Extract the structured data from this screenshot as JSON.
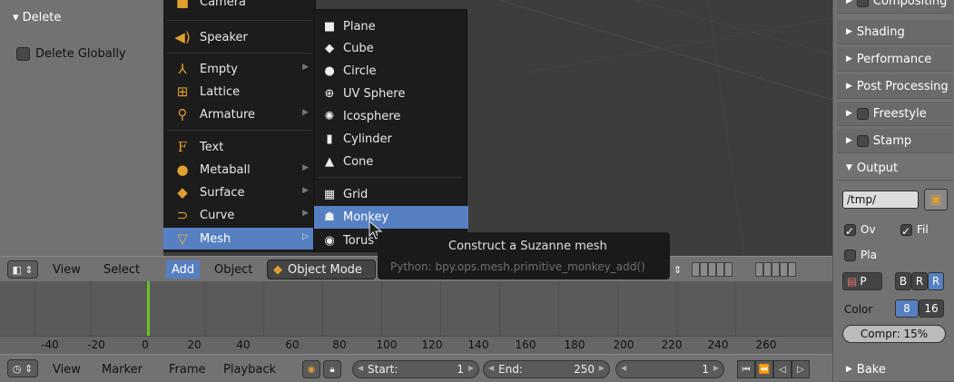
{
  "operator_panel": {
    "header": "Delete",
    "delete_globally_label": "Delete Globally"
  },
  "add_menu": {
    "items": [
      {
        "label": "Camera",
        "icon": "camera-icon"
      },
      {
        "label": "Speaker",
        "icon": "speaker-icon"
      },
      {
        "label": "Empty",
        "icon": "empty-icon"
      },
      {
        "label": "Lattice",
        "icon": "lattice-icon"
      },
      {
        "label": "Armature",
        "icon": "armature-icon"
      },
      {
        "label": "Text",
        "icon": "text-icon"
      },
      {
        "label": "Metaball",
        "icon": "metaball-icon"
      },
      {
        "label": "Surface",
        "icon": "surface-icon"
      },
      {
        "label": "Curve",
        "icon": "curve-icon"
      },
      {
        "label": "Mesh",
        "icon": "mesh-icon"
      }
    ]
  },
  "mesh_menu": {
    "items": [
      {
        "label": "Plane",
        "icon": "plane-icon"
      },
      {
        "label": "Cube",
        "icon": "cube-icon"
      },
      {
        "label": "Circle",
        "icon": "circle-icon"
      },
      {
        "label": "UV Sphere",
        "icon": "uv-sphere-icon"
      },
      {
        "label": "Icosphere",
        "icon": "icosphere-icon"
      },
      {
        "label": "Cylinder",
        "icon": "cylinder-icon"
      },
      {
        "label": "Cone",
        "icon": "cone-icon"
      },
      {
        "label": "Grid",
        "icon": "grid-icon"
      },
      {
        "label": "Monkey",
        "icon": "monkey-icon"
      },
      {
        "label": "Torus",
        "icon": "torus-icon"
      }
    ]
  },
  "tooltip": {
    "title": "Construct a Suzanne mesh",
    "python": "Python: bpy.ops.mesh.primitive_monkey_add()"
  },
  "viewport_header": {
    "view": "View",
    "select": "Select",
    "add": "Add",
    "object": "Object",
    "mode": "Object Mode"
  },
  "timeline": {
    "ticks": [
      "-40",
      "-20",
      "0",
      "20",
      "40",
      "60",
      "80",
      "100",
      "120",
      "140",
      "160",
      "180",
      "200",
      "220",
      "240",
      "260"
    ],
    "current_frame_value": 0
  },
  "timeline_header": {
    "view": "View",
    "marker": "Marker",
    "frame": "Frame",
    "playback": "Playback",
    "start_label": "Start:",
    "start_value": "1",
    "end_label": "End:",
    "end_value": "250",
    "current_value": "1"
  },
  "properties": {
    "top_partial": "Compositing",
    "shading": "Shading",
    "performance": "Performance",
    "post_processing": "Post Processing",
    "freestyle": "Freestyle",
    "stamp": "Stamp",
    "output": "Output",
    "output_path": "/tmp/",
    "ov_label": "Ov",
    "fil_label": "Fil",
    "pla_label": "Pla",
    "format_label": "P",
    "b_label": "B",
    "r_label": "R",
    "r2_label": "R",
    "color_label": "Color",
    "depth8": "8",
    "depth16": "16",
    "compression": "Compr: 15%",
    "bake": "Bake"
  },
  "colors": {
    "accent": "#5680c2",
    "playhead": "#6cc22a"
  }
}
